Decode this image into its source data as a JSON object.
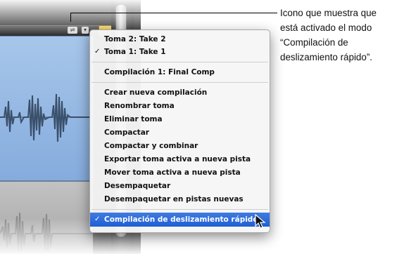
{
  "menu": {
    "items": [
      {
        "label": "Toma 2: Take 2",
        "checked": false
      },
      {
        "label": "Toma 1: Take 1",
        "checked": true
      },
      {
        "label": "Compilación 1: Final Comp",
        "checked": false
      },
      {
        "label": "Crear nueva compilación",
        "checked": false
      },
      {
        "label": "Renombrar toma",
        "checked": false
      },
      {
        "label": "Eliminar toma",
        "checked": false
      },
      {
        "label": "Compactar",
        "checked": false
      },
      {
        "label": "Compactar y combinar",
        "checked": false
      },
      {
        "label": "Exportar toma activa a nueva pista",
        "checked": false
      },
      {
        "label": "Mover toma activa a nueva pista",
        "checked": false
      },
      {
        "label": "Desempaquetar",
        "checked": false
      },
      {
        "label": "Desempaquetar en pistas nuevas",
        "checked": false
      },
      {
        "label": "Compilación de deslizamiento rápido",
        "checked": true,
        "highlighted": true
      }
    ],
    "checkmark": "✓",
    "highlight_color": "#2a69d8"
  },
  "icons": {
    "quick_swipe": "quick-swipe-comping-icon",
    "dropdown": "chevron-down-icon",
    "cursor": "arrow-cursor-icon"
  },
  "callout": {
    "lines": [
      "Icono que muestra que",
      "está activado el modo",
      "“Compilación de",
      "deslizamiento rápido”."
    ]
  }
}
